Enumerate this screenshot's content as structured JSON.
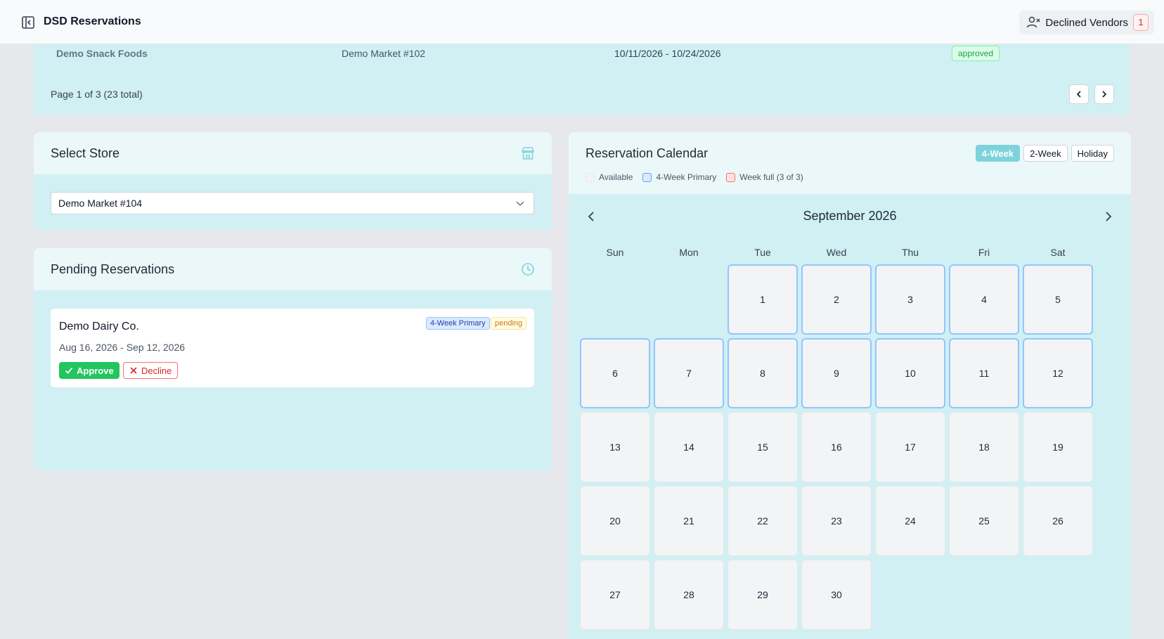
{
  "app": {
    "title": "DSD Reservations"
  },
  "header": {
    "declined_label": "Declined Vendors",
    "declined_count": "1"
  },
  "reservations_table": {
    "row": {
      "vendor": "Demo Snack Foods",
      "store": "Demo Market #102",
      "dates": "10/11/2026 - 10/24/2026",
      "status": "approved"
    },
    "pagination": "Page 1 of 3 (23 total)"
  },
  "store_select": {
    "title": "Select Store",
    "selected": "Demo Market #104"
  },
  "pending": {
    "title": "Pending Reservations",
    "items": [
      {
        "vendor": "Demo Dairy Co.",
        "dates": "Aug 16, 2026 - Sep 12, 2026",
        "type": "4-Week Primary",
        "status": "pending",
        "approve_label": "Approve",
        "decline_label": "Decline"
      }
    ]
  },
  "calendar": {
    "title": "Reservation Calendar",
    "views": [
      "4-Week",
      "2-Week",
      "Holiday"
    ],
    "active_view": "4-Week",
    "legend": [
      "Available",
      "4-Week Primary",
      "Week full (3 of 3)"
    ],
    "month": "September 2026",
    "weekdays": [
      "Sun",
      "Mon",
      "Tue",
      "Wed",
      "Thu",
      "Fri",
      "Sat"
    ],
    "first_weekday": 2,
    "days_in_month": 30,
    "primary_days": [
      1,
      2,
      3,
      4,
      5,
      6,
      7,
      8,
      9,
      10,
      11,
      12
    ]
  },
  "colors": {
    "accent": "#7dd3dc",
    "panel": "#d1f0f3",
    "approve": "#22c55e",
    "decline": "#dc2626"
  }
}
